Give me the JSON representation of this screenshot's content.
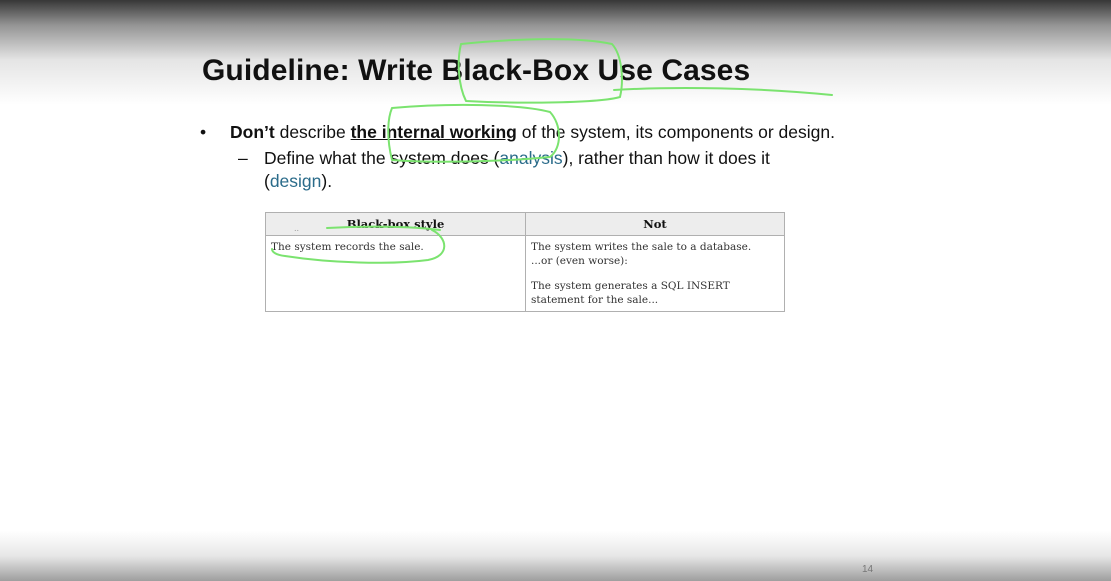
{
  "slide": {
    "title": "Guideline: Write Black-Box Use Cases",
    "bullet": {
      "marker": "•",
      "lead": "Don’t",
      "text_1": " describe ",
      "emphasis": "the internal working",
      "text_2": " of the system, its components or design."
    },
    "sub_bullet": {
      "marker": "–",
      "text_1": "Define what the system does (",
      "kw_1": "analysis",
      "text_2": "), rather than how it does it (",
      "kw_2": "design",
      "text_3": ")."
    },
    "table": {
      "header_mark": "..",
      "headers": [
        "Black-box style",
        "Not"
      ],
      "black_box_cell": "The system records the sale.",
      "not_cell_lines": [
        "The system writes the sale to a database.",
        "...or (even worse):",
        "The system generates a SQL INSERT statement for the sale..."
      ]
    },
    "page_number": "14"
  },
  "colors": {
    "keyword": "#2a6b8a",
    "ink": "#7be36f",
    "title": "#111111"
  },
  "icons": [
    "freehand-ink-annotation"
  ]
}
